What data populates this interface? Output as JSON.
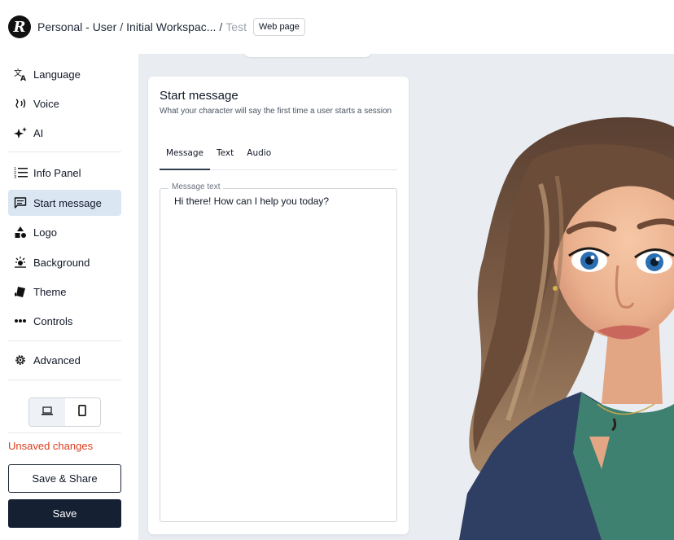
{
  "header": {
    "logo_letter": "R",
    "breadcrumb": {
      "workspace": "Personal - User",
      "project": "Initial Workspac...",
      "page": "Test"
    },
    "badge": "Web page"
  },
  "sidebar": {
    "items": [
      {
        "label": "Language",
        "icon": "translate-icon"
      },
      {
        "label": "Voice",
        "icon": "voice-icon"
      },
      {
        "label": "AI",
        "icon": "sparkle-icon"
      },
      {
        "label": "Info Panel",
        "icon": "list-icon"
      },
      {
        "label": "Start message",
        "icon": "message-icon",
        "active": true
      },
      {
        "label": "Logo",
        "icon": "shapes-icon"
      },
      {
        "label": "Background",
        "icon": "background-icon"
      },
      {
        "label": "Theme",
        "icon": "palette-icon"
      },
      {
        "label": "Controls",
        "icon": "dots-icon"
      },
      {
        "label": "Advanced",
        "icon": "gear-icon"
      }
    ],
    "device_toggle": {
      "selected": "desktop",
      "options": [
        "desktop",
        "mobile"
      ]
    },
    "unsaved_text": "Unsaved changes",
    "save_share_label": "Save & Share",
    "save_label": "Save"
  },
  "card": {
    "title": "Start message",
    "subtitle": "What your character will say the first time a user starts a session",
    "tabs": [
      "Message",
      "Text",
      "Audio"
    ],
    "active_tab": "Message",
    "field_label": "Message text",
    "field_value": "Hi there! How can I help you today?"
  },
  "colors": {
    "accent_dark": "#162033",
    "active_nav": "#dbe6f3",
    "warning": "#dc3c1c",
    "canvas": "#e9edf2"
  }
}
